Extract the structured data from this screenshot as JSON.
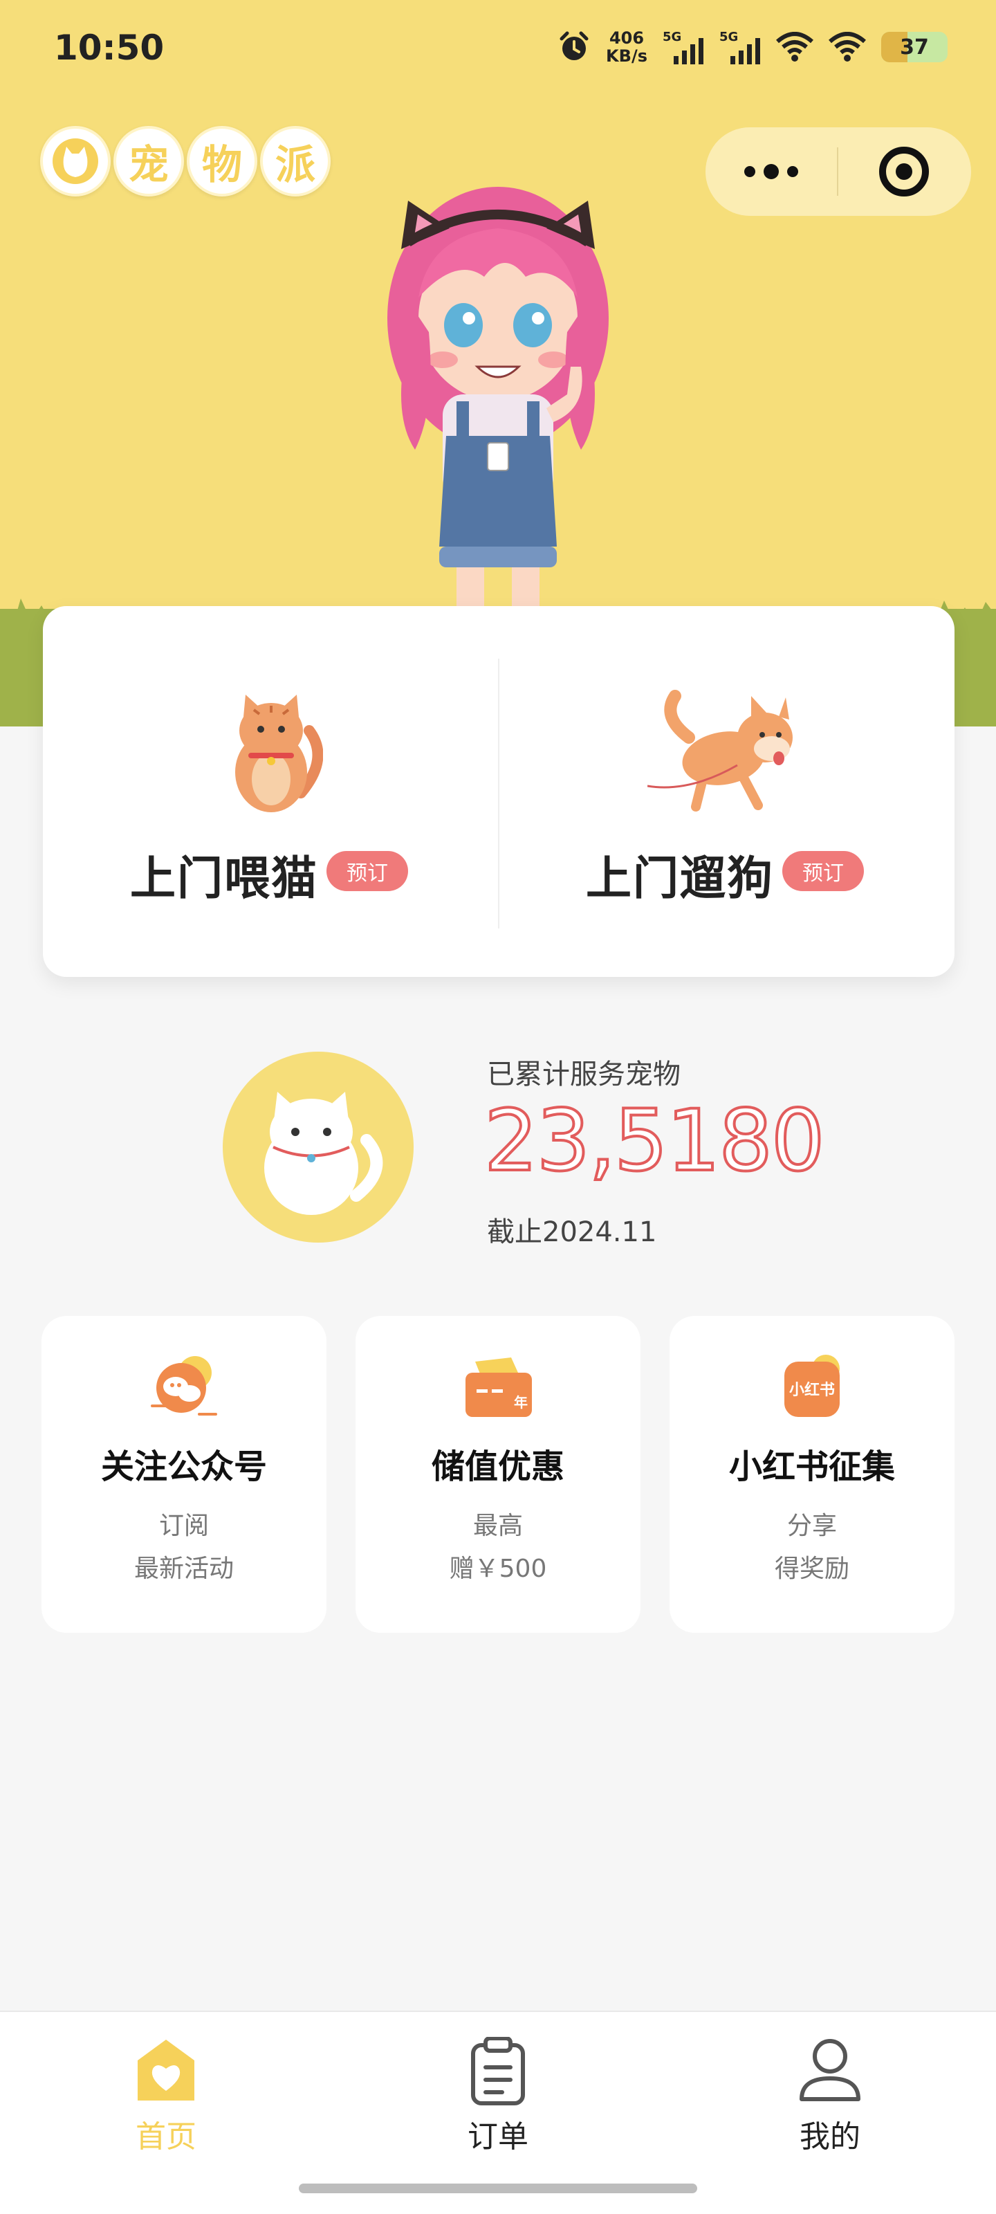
{
  "status_bar": {
    "time": "10:50",
    "net_speed_value": "406",
    "net_speed_unit": "KB/s",
    "signal1_label": "5G",
    "signal2_label": "5G",
    "battery": "37"
  },
  "header": {
    "logo_chars": [
      "宠",
      "物",
      "派"
    ]
  },
  "services": [
    {
      "title": "上门喂猫",
      "tag": "预订"
    },
    {
      "title": "上门遛狗",
      "tag": "预订"
    }
  ],
  "stats": {
    "label": "已累计服务宠物",
    "number": "23,5180",
    "date": "截止2024.11"
  },
  "promos": [
    {
      "title": "关注公众号",
      "line1": "订阅",
      "line2": "最新活动"
    },
    {
      "title": "储值优惠",
      "line1": "最高",
      "line2": "赠￥500",
      "icon_text": "年"
    },
    {
      "title": "小红书征集",
      "line1": "分享",
      "line2": "得奖励",
      "icon_text": "小红书"
    }
  ],
  "tabbar": {
    "items": [
      {
        "label": "首页",
        "active": true
      },
      {
        "label": "订单",
        "active": false
      },
      {
        "label": "我的",
        "active": false
      }
    ]
  },
  "colors": {
    "brand_yellow": "#f6de7a",
    "accent_red": "#e25c5c",
    "tag_red": "#f07a7a",
    "grass_green": "#9fb24a"
  }
}
